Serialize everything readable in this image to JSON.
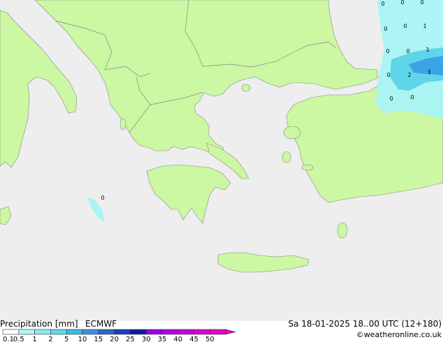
{
  "header": {
    "title": "Precipitation [mm]",
    "model": "ECMWF",
    "valid_time": "Sa 18-01-2025 18..00 UTC (12+180)",
    "credit": "©weatheronline.co.uk"
  },
  "colors": {
    "sea": "#eeeeee",
    "land": "#ccf7a3",
    "border": "#888888",
    "precip_light": "#a8f3f5",
    "precip_mid": "#5fd5ea",
    "precip_heavy": "#3aa4e6"
  },
  "legend": {
    "labels": [
      "0.1",
      "0.5",
      "1",
      "2",
      "5",
      "10",
      "15",
      "20",
      "25",
      "30",
      "35",
      "40",
      "45",
      "50"
    ],
    "colors": [
      "#ffffff",
      "#b4f5f5",
      "#8ce8f0",
      "#64d7ea",
      "#3cb9e2",
      "#3c8ee0",
      "#3264d2",
      "#1e3cbe",
      "#0a1e96",
      "#9b00e6",
      "#b400e6",
      "#c800dc",
      "#dc00d2",
      "#e600c8"
    ]
  },
  "map_labels": [
    {
      "text": "0"
    },
    {
      "text": "0"
    },
    {
      "text": "0"
    },
    {
      "text": "0"
    },
    {
      "text": "1"
    },
    {
      "text": "0"
    },
    {
      "text": "0"
    },
    {
      "text": "1"
    },
    {
      "text": "0"
    },
    {
      "text": "2"
    },
    {
      "text": "3"
    },
    {
      "text": "0"
    },
    {
      "text": "0"
    },
    {
      "text": "0"
    },
    {
      "text": "0"
    }
  ]
}
